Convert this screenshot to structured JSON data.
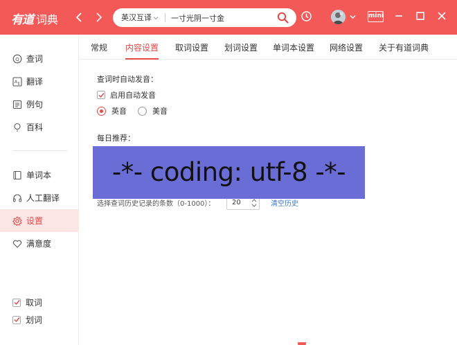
{
  "app": {
    "brand": "有道",
    "title": "词典"
  },
  "search": {
    "lang": "英汉互译",
    "query": "一寸光阴一寸金"
  },
  "topbar": {
    "mini_label": "mini"
  },
  "sidebar": {
    "items": [
      {
        "label": "查词",
        "icon": "search-text-icon"
      },
      {
        "label": "翻译",
        "icon": "translate-icon"
      },
      {
        "label": "例句",
        "icon": "example-sentence-icon"
      },
      {
        "label": "百科",
        "icon": "bulb-icon"
      },
      {
        "label": "单词本",
        "icon": "wordbook-icon"
      },
      {
        "label": "人工翻译",
        "icon": "headset-icon"
      },
      {
        "label": "设置",
        "icon": "gear-icon",
        "active": true
      },
      {
        "label": "满意度",
        "icon": "heart-icon"
      }
    ],
    "checks": [
      {
        "label": "取词",
        "checked": true
      },
      {
        "label": "划词",
        "checked": true
      }
    ]
  },
  "tabs": [
    {
      "label": "常规"
    },
    {
      "label": "内容设置",
      "active": true
    },
    {
      "label": "取词设置"
    },
    {
      "label": "划词设置"
    },
    {
      "label": "单词本设置"
    },
    {
      "label": "网络设置"
    },
    {
      "label": "关于有道词典"
    }
  ],
  "content": {
    "auto_pron_title": "查词时自动发音：",
    "enable_auto_pron": "启用自动发音",
    "accent_uk": "英音",
    "accent_us": "美音",
    "accent_selected": "英音",
    "daily_title": "每日推荐：",
    "overlay_text": "-*- coding: utf-8 -*-",
    "history_label": "选择查词历史记录的条数（0-1000）：",
    "history_value": "20",
    "clear_history": "清空历史"
  },
  "colors": {
    "brand": "#f35a57",
    "accent": "#e24a48",
    "overlay": "#6a6dd6",
    "link": "#3b78c8"
  }
}
